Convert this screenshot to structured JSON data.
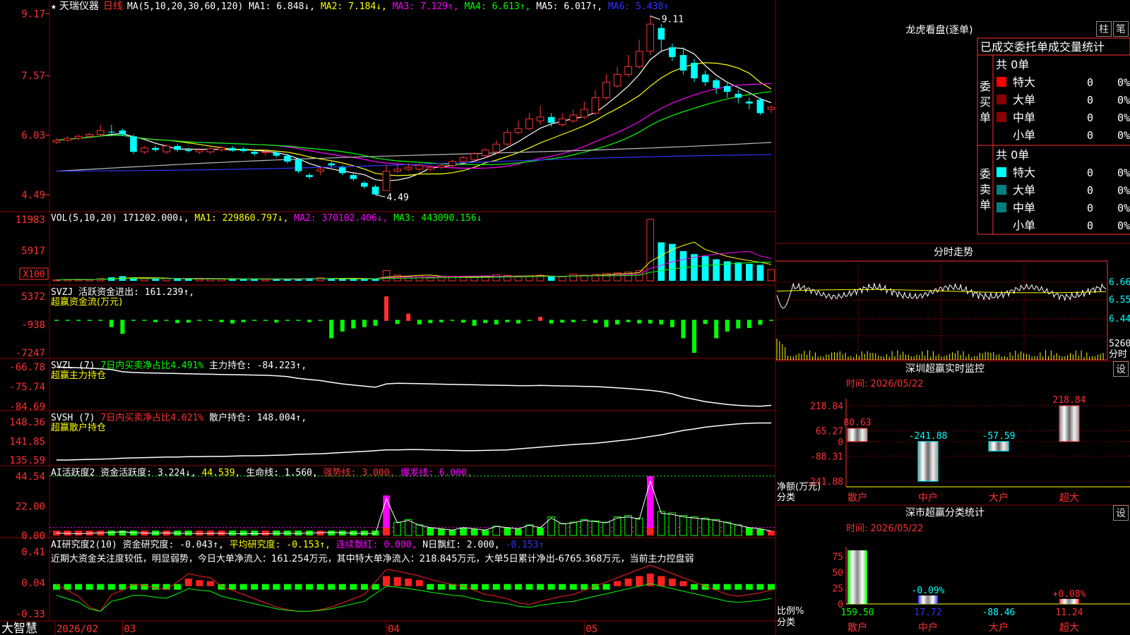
{
  "app": {
    "brand": "大智慧",
    "star": "★",
    "stock_name": "天瑞仪器",
    "period": "日线"
  },
  "colors": {
    "up": "#ff3030",
    "down": "#00ffff",
    "grid": "#8b0000",
    "ma1": "#ffffff",
    "ma2": "#ffff00",
    "ma3": "#ff00ff",
    "ma4": "#00ff00",
    "ma5": "#bbbbbb",
    "ma6": "#3333ff"
  },
  "main_panel": {
    "legend": [
      {
        "text": "MA(5,10,20,30,60,120)",
        "color": "#ffffff"
      },
      {
        "text": "MA1: 6.848↓,",
        "color": "#ffffff"
      },
      {
        "text": "MA2: 7.184↓,",
        "color": "#ffff00"
      },
      {
        "text": "MA3: 7.129↑,",
        "color": "#ff00ff"
      },
      {
        "text": "MA4: 6.613↑,",
        "color": "#00ff00"
      },
      {
        "text": "MA5: 6.017↑,",
        "color": "#ffffff"
      },
      {
        "text": "MA6: 5.438↑",
        "color": "#3333ff"
      }
    ],
    "y_ticks": [
      "9.17",
      "7.57",
      "6.03",
      "4.49"
    ],
    "high_label": "9.11",
    "low_label": "4.49"
  },
  "vol_panel": {
    "legend": [
      {
        "text": "VOL(5,10,20)",
        "color": "#ffffff"
      },
      {
        "text": "171202.000↓,",
        "color": "#ffffff"
      },
      {
        "text": "MA1: 229860.797↓,",
        "color": "#ffff00"
      },
      {
        "text": "MA2: 370102.406↓,",
        "color": "#ff00ff"
      },
      {
        "text": "MA3: 443090.156↓",
        "color": "#00ff00"
      }
    ],
    "y_ticks": [
      "11983",
      "5917"
    ],
    "unit": "X100"
  },
  "svzj_panel": {
    "legend": [
      {
        "text": "SVZJ",
        "color": "#ffffff"
      },
      {
        "text": "活跃资金进出: 161.239↑,",
        "color": "#ffffff"
      }
    ],
    "subtitle": "超赢资金流(万元)",
    "y_ticks": [
      "5372",
      "-938",
      "-7247"
    ]
  },
  "svzl_panel": {
    "legend": [
      {
        "text": "SVZL (7)",
        "color": "#ffffff"
      },
      {
        "text": "7日内买卖净占比4.491%",
        "color": "#00ff00"
      },
      {
        "text": "主力持仓: -84.223↑,",
        "color": "#ffffff"
      }
    ],
    "subtitle": "超赢主力持仓",
    "y_ticks": [
      "-66.78",
      "-75.74",
      "-84.69"
    ]
  },
  "svsh_panel": {
    "legend": [
      {
        "text": "SVSH (7)",
        "color": "#ffffff"
      },
      {
        "text": "7日内买卖净占比4.021%",
        "color": "#ff3030"
      },
      {
        "text": "散户持仓: 148.004↑,",
        "color": "#ffffff"
      }
    ],
    "subtitle": "超赢散户持仓",
    "y_ticks": [
      "148.36",
      "141.85",
      "135.59"
    ]
  },
  "ai_panel": {
    "legend": [
      {
        "text": "AI活跃度2",
        "color": "#ffffff"
      },
      {
        "text": "资金活跃度: 3.224↓,",
        "color": "#ffffff"
      },
      {
        "text": "44.539,",
        "color": "#ffff00"
      },
      {
        "text": "生命线: 1.560,",
        "color": "#ffffff"
      },
      {
        "text": "强势线: 3.000,",
        "color": "#ff3030"
      },
      {
        "text": "爆发线: 6.000,",
        "color": "#ff00ff"
      }
    ],
    "y_ticks": [
      "44.54",
      "22.00",
      "0.00"
    ]
  },
  "ai2_panel": {
    "legend": [
      {
        "text": "AI研究度2(10)",
        "color": "#ffffff"
      },
      {
        "text": "资金研究度: -0.043↑,",
        "color": "#ffffff"
      },
      {
        "text": "平均研究度: -0.153↑,",
        "color": "#ffff00"
      },
      {
        "text": "连续飘红: 0.000,",
        "color": "#ff00ff"
      },
      {
        "text": "N日飘红: 2.000,",
        "color": "#ffffff"
      },
      {
        "text": "-0.153↑",
        "color": "#3333ff"
      }
    ],
    "note": "近期大资金关注度较低，明显弱势，今日大单净流入：161.254万元，其中特大单净流入：218.845万元，大单5日累计净出-6765.368万元，当前主力控盘弱",
    "y_ticks": [
      "0.41",
      "0.04",
      "-0.33"
    ]
  },
  "date_axis": {
    "labels": [
      "2026/02",
      "03",
      "04",
      "05"
    ]
  },
  "dragon_tiger": {
    "title": "龙虎看盘(逐单)",
    "btn_zhu": "柱",
    "btn_bi": "笔",
    "subtitle": "已成交委托单成交量统计",
    "buy_label": "委买单",
    "sell_label": "委卖单",
    "buy_total": "共 0单",
    "sell_total": "共 0单",
    "buy_rows": [
      {
        "label": "特大",
        "color": "#ff0000",
        "count": "0",
        "pct": "0%"
      },
      {
        "label": "大单",
        "color": "#8b0000",
        "count": "0",
        "pct": "0%"
      },
      {
        "label": "中单",
        "color": "#8b0000",
        "count": "0",
        "pct": "0%"
      },
      {
        "label": "小单",
        "color": "",
        "count": "0",
        "pct": "0%"
      }
    ],
    "sell_rows": [
      {
        "label": "特大",
        "color": "#00ffff",
        "count": "0",
        "pct": "0%"
      },
      {
        "label": "大单",
        "color": "#008080",
        "count": "0",
        "pct": "0%"
      },
      {
        "label": "中单",
        "color": "#008080",
        "count": "0",
        "pct": "0%"
      },
      {
        "label": "小单",
        "color": "",
        "count": "0",
        "pct": "0%"
      }
    ]
  },
  "intraday": {
    "title": "分时走势",
    "y_ticks": [
      "6.66",
      "6.55",
      "6.44"
    ],
    "vol_tick": "5260",
    "vol_label": "分时"
  },
  "sz_monitor": {
    "title": "深圳超赢实时监控",
    "btn": "设",
    "time_label": "时间: 2026/05/22",
    "y_ticks": [
      "218.84",
      "65.27",
      "0",
      "-88.31",
      "-241.88"
    ],
    "axis_label_1": "净额(万元)",
    "axis_label_2": "分类"
  },
  "sz_classify": {
    "title": "深市超赢分类统计",
    "btn": "设",
    "time_label": "时间: 2026/05/22",
    "y_ticks": [
      "75",
      "50",
      "25",
      "0"
    ],
    "axis_label_1": "比例%",
    "axis_label_2": "分类"
  },
  "chart_data": [
    {
      "type": "candlestick",
      "title": "天瑞仪器 日线",
      "x": [
        "2026/02",
        "03",
        "04",
        "05"
      ],
      "ylim": [
        4.49,
        9.17
      ],
      "high": [
        5.95,
        6.0,
        6.05,
        6.1,
        6.3,
        6.3,
        6.2,
        6.05,
        5.75,
        5.75,
        5.8,
        5.8,
        5.7,
        5.7,
        5.72,
        5.75,
        5.75,
        5.72,
        5.65,
        5.65,
        5.62,
        5.55,
        5.45,
        5.05,
        5.2,
        5.35,
        5.25,
        5.05,
        4.85,
        4.75,
        5.25,
        5.3,
        5.3,
        5.3,
        5.25,
        5.3,
        5.4,
        5.5,
        5.6,
        5.7,
        5.9,
        6.2,
        6.4,
        6.6,
        6.8,
        6.6,
        6.6,
        6.7,
        6.9,
        7.2,
        7.6,
        7.8,
        8.1,
        8.5,
        9.11,
        8.9,
        8.4,
        8.3,
        8.0,
        7.7,
        7.5,
        7.4,
        7.2,
        7.0,
        7.0,
        6.8
      ],
      "low": [
        5.8,
        5.85,
        5.9,
        5.95,
        6.0,
        6.0,
        6.0,
        5.55,
        5.55,
        5.6,
        5.55,
        5.6,
        5.58,
        5.55,
        5.55,
        5.6,
        5.6,
        5.58,
        5.5,
        5.5,
        5.45,
        5.3,
        5.05,
        4.9,
        5.0,
        5.2,
        5.0,
        4.85,
        4.65,
        4.49,
        4.6,
        5.05,
        5.1,
        5.1,
        5.1,
        5.15,
        5.2,
        5.3,
        5.35,
        5.45,
        5.55,
        5.75,
        6.05,
        6.15,
        6.3,
        6.25,
        6.25,
        6.35,
        6.45,
        6.55,
        6.95,
        7.25,
        7.55,
        7.75,
        8.1,
        8.2,
        7.95,
        7.6,
        7.4,
        7.3,
        7.1,
        7.0,
        6.85,
        6.7,
        6.55,
        6.6
      ],
      "open": [
        5.85,
        5.9,
        5.95,
        6.0,
        6.05,
        6.12,
        6.15,
        6.0,
        5.6,
        5.7,
        5.6,
        5.75,
        5.65,
        5.6,
        5.6,
        5.65,
        5.7,
        5.68,
        5.6,
        5.6,
        5.58,
        5.5,
        5.4,
        5.0,
        5.1,
        5.3,
        5.2,
        5.0,
        4.8,
        4.7,
        4.6,
        5.1,
        5.15,
        5.15,
        5.15,
        5.2,
        5.25,
        5.35,
        5.4,
        5.5,
        5.6,
        5.8,
        6.1,
        6.2,
        6.4,
        6.5,
        6.3,
        6.4,
        6.5,
        6.6,
        7.0,
        7.3,
        7.6,
        7.8,
        8.2,
        8.8,
        8.3,
        8.1,
        7.9,
        7.6,
        7.45,
        7.3,
        7.1,
        6.9,
        6.95,
        6.7
      ],
      "close": [
        5.9,
        5.95,
        6.0,
        6.05,
        6.15,
        6.1,
        6.05,
        5.6,
        5.7,
        5.65,
        5.75,
        5.65,
        5.62,
        5.65,
        5.68,
        5.7,
        5.63,
        5.62,
        5.55,
        5.6,
        5.5,
        5.35,
        5.1,
        4.95,
        5.15,
        5.25,
        5.05,
        4.9,
        4.7,
        4.5,
        5.1,
        5.15,
        5.2,
        5.25,
        5.2,
        5.25,
        5.35,
        5.45,
        5.55,
        5.65,
        5.8,
        6.1,
        6.2,
        6.45,
        6.5,
        6.35,
        6.45,
        6.55,
        6.7,
        7.0,
        7.4,
        7.6,
        7.8,
        8.2,
        8.9,
        8.5,
        8.05,
        7.7,
        7.5,
        7.4,
        7.25,
        7.15,
        7.0,
        6.85,
        6.6,
        6.75
      ]
    },
    {
      "type": "bar",
      "title": "VOL(5,10,20)",
      "ylim": [
        0,
        11983
      ],
      "unit": "X100",
      "values": [
        180,
        250,
        300,
        280,
        450,
        680,
        900,
        650,
        380,
        350,
        420,
        380,
        350,
        330,
        350,
        360,
        340,
        330,
        310,
        300,
        320,
        300,
        350,
        520,
        600,
        500,
        450,
        400,
        380,
        350,
        2000,
        1100,
        800,
        1050,
        650,
        900,
        850,
        700,
        680,
        900,
        1200,
        1050,
        750,
        850,
        1100,
        850,
        780,
        1300,
        1100,
        1250,
        1450,
        1550,
        1700,
        2000,
        11983,
        7500,
        7200,
        5800,
        5200,
        4800,
        4200,
        3800,
        3600,
        3300,
        3100,
        2200
      ]
    },
    {
      "type": "bar",
      "title": "SVZJ 超赢资金流(万元)",
      "ylim": [
        -7247,
        5372
      ],
      "values": [
        -120,
        -80,
        -150,
        -60,
        -200,
        -1500,
        -3000,
        -300,
        -200,
        -400,
        -150,
        -600,
        -500,
        -100,
        -200,
        -400,
        -700,
        -400,
        -300,
        -200,
        -500,
        -300,
        -200,
        -400,
        -300,
        -4000,
        -2500,
        -1800,
        -1500,
        -1200,
        5372,
        -800,
        1500,
        -900,
        -600,
        -400,
        -300,
        -500,
        -1200,
        -600,
        -900,
        -400,
        -700,
        -300,
        800,
        -700,
        -500,
        -400,
        -300,
        -600,
        -1500,
        -900,
        -400,
        -700,
        -700,
        -900,
        -1500,
        -4000,
        -7247,
        -800,
        -4000,
        -2500,
        -1800,
        -1700,
        -1000,
        -161
      ]
    },
    {
      "type": "line",
      "title": "SVZL 超赢主力持仓",
      "ylim": [
        -84.69,
        -66.78
      ],
      "values": [
        -66.9,
        -67.0,
        -67.2,
        -67.4,
        -67.6,
        -68.0,
        -69.0,
        -69.3,
        -69.5,
        -69.6,
        -69.7,
        -69.8,
        -69.9,
        -70.0,
        -70.1,
        -70.2,
        -70.3,
        -70.4,
        -70.5,
        -70.6,
        -70.8,
        -71.2,
        -72.0,
        -72.5,
        -73.0,
        -73.8,
        -74.5,
        -75.0,
        -75.5,
        -76.0,
        -74.5,
        -74.2,
        -74.3,
        -74.4,
        -74.5,
        -74.6,
        -74.7,
        -74.8,
        -74.9,
        -75.0,
        -75.1,
        -75.2,
        -75.3,
        -75.3,
        -75.2,
        -75.3,
        -75.4,
        -75.5,
        -75.6,
        -75.7,
        -76.0,
        -76.3,
        -76.6,
        -77.0,
        -77.4,
        -78.0,
        -79.0,
        -80.5,
        -81.5,
        -82.5,
        -83.2,
        -83.8,
        -84.2,
        -84.5,
        -84.6,
        -84.22
      ]
    },
    {
      "type": "line",
      "title": "SVSH 超赢散户持仓",
      "ylim": [
        135.59,
        148.36
      ],
      "values": [
        135.6,
        135.6,
        135.7,
        135.8,
        135.9,
        136.0,
        136.2,
        136.3,
        136.4,
        136.5,
        136.6,
        136.6,
        136.7,
        136.7,
        136.8,
        136.8,
        136.9,
        137.0,
        137.0,
        137.1,
        137.2,
        137.3,
        137.5,
        137.6,
        137.7,
        137.9,
        138.1,
        138.3,
        138.5,
        138.7,
        139.0,
        139.0,
        139.1,
        139.1,
        139.0,
        138.9,
        138.8,
        138.7,
        138.7,
        138.8,
        138.9,
        139.0,
        139.3,
        139.6,
        139.9,
        140.2,
        140.5,
        140.8,
        141.0,
        141.2,
        141.6,
        142.0,
        142.4,
        142.9,
        143.5,
        144.0,
        144.8,
        145.5,
        146.0,
        146.6,
        147.0,
        147.4,
        147.7,
        147.9,
        148.0,
        148.004
      ]
    },
    {
      "type": "bar",
      "title": "AI活跃度2",
      "ylim": [
        0,
        44.54
      ],
      "values": [
        1.5,
        1.2,
        1.0,
        1.3,
        1.6,
        2.0,
        2.5,
        1.8,
        1.5,
        1.4,
        1.6,
        1.3,
        1.2,
        1.1,
        1.2,
        1.3,
        1.1,
        1.0,
        1.1,
        1.0,
        1.2,
        1.3,
        1.1,
        1.5,
        1.8,
        2.0,
        1.6,
        1.4,
        1.2,
        1.1,
        30,
        10,
        12,
        8,
        6,
        5,
        4,
        6,
        5,
        4,
        7,
        6,
        5,
        8,
        6,
        14,
        9,
        10,
        12,
        11,
        10,
        14,
        15,
        13,
        44.54,
        18,
        17,
        15,
        14,
        13,
        12,
        10,
        8,
        6,
        5,
        3.2
      ]
    },
    {
      "type": "line",
      "title": "AI研究度2(10)",
      "ylim": [
        -0.33,
        0.41
      ],
      "values": [
        0.02,
        -0.05,
        -0.12,
        -0.25,
        -0.3,
        -0.1,
        -0.05,
        0.02,
        0.01,
        -0.02,
        -0.04,
        0.05,
        0.15,
        0.12,
        0.1,
        0.0,
        -0.05,
        -0.1,
        -0.15,
        -0.2,
        -0.25,
        -0.28,
        -0.3,
        -0.3,
        -0.28,
        -0.25,
        -0.2,
        -0.15,
        -0.1,
        0.05,
        0.2,
        0.18,
        0.15,
        0.12,
        0.08,
        0.05,
        0.02,
        0.0,
        -0.05,
        -0.1,
        -0.12,
        -0.15,
        -0.2,
        -0.22,
        -0.18,
        -0.15,
        -0.12,
        -0.1,
        -0.05,
        0.0,
        0.05,
        0.1,
        0.15,
        0.2,
        0.25,
        0.2,
        0.15,
        0.1,
        0.05,
        0.0,
        -0.05,
        -0.1,
        -0.12,
        -0.1,
        -0.08,
        -0.043
      ]
    },
    {
      "type": "bar",
      "title": "深圳超赢实时监控",
      "categories": [
        "散户",
        "中户",
        "大户",
        "超大"
      ],
      "values": [
        80.63,
        -241.88,
        -57.59,
        218.84
      ],
      "ylim": [
        -241.88,
        218.84
      ]
    },
    {
      "type": "bar",
      "title": "深市超赢分类统计",
      "categories": [
        "散户",
        "中户",
        "大户",
        "超大"
      ],
      "values": [
        159.5,
        17.72,
        -88.46,
        11.24
      ],
      "bar_labels": [
        "",
        "-0.09%",
        "",
        "+0.08%"
      ],
      "ylim": [
        0,
        75
      ]
    }
  ]
}
